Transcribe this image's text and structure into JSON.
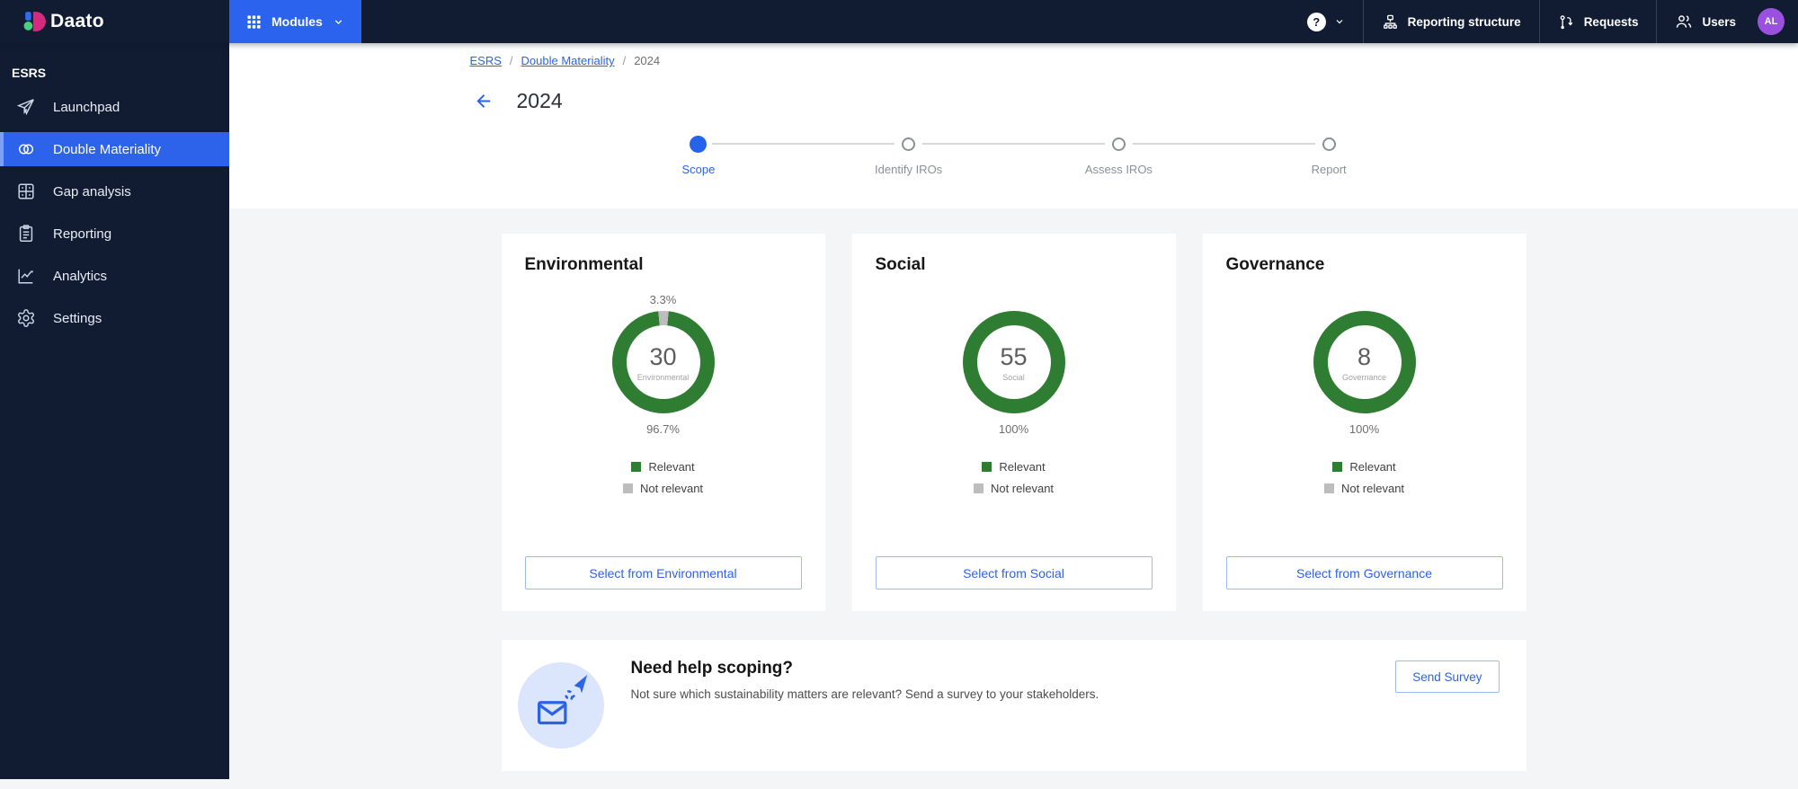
{
  "topbar": {
    "logo_text": "Daato",
    "modules_label": "Modules",
    "help_glyph": "?",
    "nav": [
      {
        "label": "Reporting structure",
        "icon": "sitemap-icon"
      },
      {
        "label": "Requests",
        "icon": "pull-request-icon"
      },
      {
        "label": "Users",
        "icon": "users-icon"
      }
    ],
    "avatar_initials": "AL"
  },
  "sidebar": {
    "section_label": "ESRS",
    "items": [
      {
        "label": "Launchpad",
        "icon": "paper-plane-icon",
        "active": false
      },
      {
        "label": "Double Materiality",
        "icon": "overlapping-circles-icon",
        "active": true
      },
      {
        "label": "Gap analysis",
        "icon": "grid-icon",
        "active": false
      },
      {
        "label": "Reporting",
        "icon": "clipboard-icon",
        "active": false
      },
      {
        "label": "Analytics",
        "icon": "line-chart-icon",
        "active": false
      },
      {
        "label": "Settings",
        "icon": "gear-icon",
        "active": false
      }
    ]
  },
  "breadcrumb": {
    "separator": "/",
    "items": [
      {
        "label": "ESRS",
        "link": true
      },
      {
        "label": "Double Materiality",
        "link": true
      },
      {
        "label": "2024",
        "link": false
      }
    ]
  },
  "page": {
    "title": "2024"
  },
  "stepper": {
    "steps": [
      {
        "label": "Scope",
        "state": "current"
      },
      {
        "label": "Identify IROs",
        "state": "upcoming"
      },
      {
        "label": "Assess IROs",
        "state": "upcoming"
      },
      {
        "label": "Report",
        "state": "upcoming"
      }
    ]
  },
  "legend": {
    "relevant": "Relevant",
    "not_relevant": "Not relevant"
  },
  "cards": [
    {
      "title": "Environmental",
      "count": "30",
      "center_label": "Environmental",
      "top_percent": "3.3%",
      "bottom_percent": "96.7%",
      "donut": {
        "relevant_pct": 96.7,
        "not_relevant_pct": 3.3
      },
      "button_label": "Select from Environmental"
    },
    {
      "title": "Social",
      "count": "55",
      "center_label": "Social",
      "top_percent": "",
      "bottom_percent": "100%",
      "donut": {
        "relevant_pct": 100,
        "not_relevant_pct": 0
      },
      "button_label": "Select from Social"
    },
    {
      "title": "Governance",
      "count": "8",
      "center_label": "Governance",
      "top_percent": "",
      "bottom_percent": "100%",
      "donut": {
        "relevant_pct": 100,
        "not_relevant_pct": 0
      },
      "button_label": "Select from Governance"
    }
  ],
  "banner": {
    "title": "Need help scoping?",
    "subtitle": "Not sure which sustainability matters are relevant? Send a survey to your stakeholders.",
    "button_label": "Send Survey"
  },
  "colors": {
    "accent_blue": "#2c63e6",
    "modules_blue": "#2c63ee",
    "active_nav_blue": "#2d63ea",
    "topbar_navy": "#111c33",
    "relevant_green": "#2e7d32",
    "not_relevant_gray": "#bdbdbd",
    "avatar_purple": "#9b51e0",
    "page_bg": "#f4f5f7"
  },
  "chart_data": [
    {
      "type": "pie",
      "variant": "donut",
      "title": "Environmental",
      "center_value": 30,
      "center_label": "Environmental",
      "slices": [
        {
          "label": "Relevant",
          "percent": 96.7,
          "color": "#2e7d32"
        },
        {
          "label": "Not relevant",
          "percent": 3.3,
          "color": "#bdbdbd"
        }
      ],
      "data_labels": [
        "3.3%",
        "96.7%"
      ],
      "legend": [
        "Relevant",
        "Not relevant"
      ],
      "legend_position": "bottom"
    },
    {
      "type": "pie",
      "variant": "donut",
      "title": "Social",
      "center_value": 55,
      "center_label": "Social",
      "slices": [
        {
          "label": "Relevant",
          "percent": 100,
          "color": "#2e7d32"
        },
        {
          "label": "Not relevant",
          "percent": 0,
          "color": "#bdbdbd"
        }
      ],
      "data_labels": [
        "100%"
      ],
      "legend": [
        "Relevant",
        "Not relevant"
      ],
      "legend_position": "bottom"
    },
    {
      "type": "pie",
      "variant": "donut",
      "title": "Governance",
      "center_value": 8,
      "center_label": "Governance",
      "slices": [
        {
          "label": "Relevant",
          "percent": 100,
          "color": "#2e7d32"
        },
        {
          "label": "Not relevant",
          "percent": 0,
          "color": "#bdbdbd"
        }
      ],
      "data_labels": [
        "100%"
      ],
      "legend": [
        "Relevant",
        "Not relevant"
      ],
      "legend_position": "bottom"
    }
  ]
}
